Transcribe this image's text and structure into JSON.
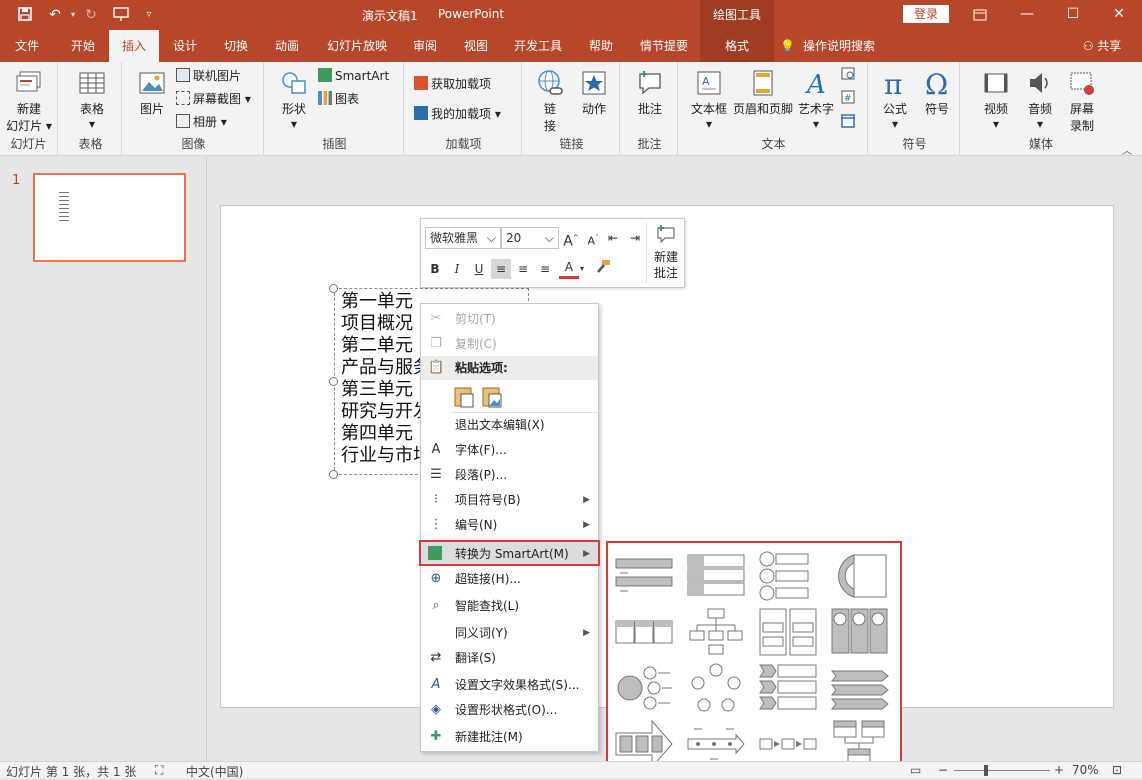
{
  "titlebar": {
    "doc_title": "演示文稿1",
    "app_name": "PowerPoint",
    "context_tools": "绘图工具",
    "login": "登录"
  },
  "tabs": [
    "文件",
    "开始",
    "插入",
    "设计",
    "切换",
    "动画",
    "幻灯片放映",
    "审阅",
    "视图",
    "开发工具",
    "帮助",
    "情节提要",
    "格式"
  ],
  "active_tab": "插入",
  "tell_me": "操作说明搜索",
  "share": "共享",
  "ribbon": {
    "groups": {
      "slides": "幻灯片",
      "tables": "表格",
      "images": "图像",
      "illustrations": "插图",
      "addins": "加载项",
      "links": "链接",
      "comments": "批注",
      "text": "文本",
      "symbols": "符号",
      "media": "媒体"
    },
    "buttons": {
      "new_slide_1": "新建",
      "new_slide_2": "幻灯片",
      "table": "表格",
      "picture": "图片",
      "online_pictures": "联机图片",
      "screenshot": "屏幕截图",
      "album": "相册",
      "shapes": "形状",
      "smartart": "SmartArt",
      "chart": "图表",
      "get_addins": "获取加载项",
      "my_addins": "我的加载项",
      "link_1": "链",
      "link_2": "接",
      "action": "动作",
      "comment": "批注",
      "textbox": "文本框",
      "header_footer": "页眉和页脚",
      "wordart": "艺术字",
      "equation": "公式",
      "symbol": "符号",
      "video": "视频",
      "audio": "音频",
      "screen_rec_1": "屏幕",
      "screen_rec_2": "录制"
    }
  },
  "slide_panel": {
    "number": "1"
  },
  "textbox_lines": [
    "第一单元",
    "项目概况",
    "第二单元",
    "产品与服务",
    "第三单元",
    "研究与开发",
    "第四单元",
    "行业与市场"
  ],
  "mini_toolbar": {
    "font": "微软雅黑",
    "size": "20",
    "new_comment_1": "新建",
    "new_comment_2": "批注"
  },
  "context_menu": {
    "cut": "剪切(T)",
    "copy": "复制(C)",
    "paste_options": "粘贴选项:",
    "exit_edit": "退出文本编辑(X)",
    "font": "字体(F)...",
    "paragraph": "段落(P)...",
    "bullets": "项目符号(B)",
    "numbering": "编号(N)",
    "convert_smartart": "转换为 SmartArt(M)",
    "hyperlink": "超链接(H)...",
    "smart_lookup": "智能查找(L)",
    "synonyms": "同义词(Y)",
    "translate": "翻译(S)",
    "text_effects": "设置文字效果格式(S)...",
    "shape_format": "设置形状格式(O)...",
    "new_comment": "新建批注(M)"
  },
  "status": {
    "slide_info": "幻灯片 第 1 张，共 1 张",
    "language": "中文(中国)",
    "zoom": "70%"
  },
  "colors": {
    "accent": "#b7472a",
    "highlight": "#d43c3c"
  }
}
